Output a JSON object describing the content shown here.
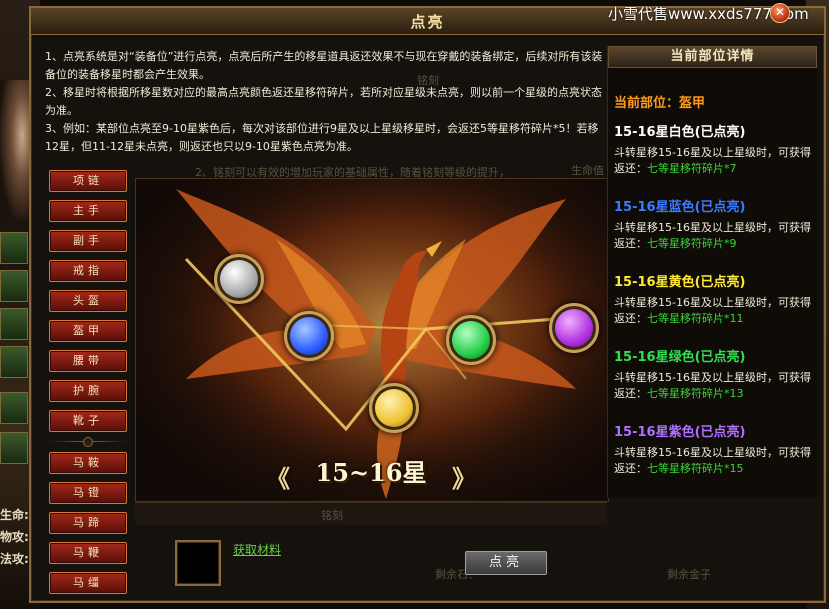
{
  "window": {
    "title": "点亮",
    "watermark": "小雪代售www.xxds777.com",
    "close_glyph": "✕"
  },
  "rules": [
    "1、点亮系统是对“装备位”进行点亮，点亮后所产生的移星道具返还效果不与现在穿戴的装备绑定，后续对所有该装备位的装备移星时都会产生效果。",
    "2、移星时将根据所移星数对应的最高点亮颜色返还星移符碎片，若所对应星级未点亮，则以前一个星级的点亮状态为准。",
    "3、例如：某部位点亮至9-10星紫色后，每次对该部位进行9星及以上星级移星时，会返还5等星移符碎片*5！若移12星，但11-12星未点亮，则返还也只以9-10星紫色点亮为准。"
  ],
  "background_text": {
    "a": "铭刻",
    "b": "2、铭刻可以有效的增加玩家的基础属性，随着铭刻等级的提升，",
    "c": "生命值",
    "d": "铭刻",
    "e": "剩余石：",
    "f": "剩余金子"
  },
  "hero_stats": [
    "生命:",
    "物攻:",
    "法攻:"
  ],
  "slots": [
    {
      "label": "项链"
    },
    {
      "label": "主手"
    },
    {
      "label": "副手"
    },
    {
      "label": "戒指"
    },
    {
      "label": "头盔"
    },
    {
      "label": "盔甲"
    },
    {
      "label": "腰带"
    },
    {
      "label": "护腕"
    },
    {
      "label": "靴子"
    },
    {
      "label": "马鞍"
    },
    {
      "label": "马镫"
    },
    {
      "label": "马蹄"
    },
    {
      "label": "马鞭"
    },
    {
      "label": "马缰"
    }
  ],
  "star_range": "15~16星",
  "orbs": [
    {
      "name": "white-orb",
      "color": "#e8e8e8"
    },
    {
      "name": "blue-orb",
      "color": "#2a5aff"
    },
    {
      "name": "gold-orb",
      "color": "#f0c030"
    },
    {
      "name": "green-orb",
      "color": "#22cc44"
    },
    {
      "name": "purple-orb",
      "color": "#b030e0"
    }
  ],
  "material": {
    "link_text": "获取材料"
  },
  "light_button": "点亮",
  "detail": {
    "header": "当前部位详情",
    "current_part": "当前部位：盔甲",
    "tiers": [
      {
        "title": "15-16星白色(已点亮)",
        "color": "#ffffff",
        "desc": "斗转星移15-16星及以上星级时，可获得返还：",
        "reward": "七等星移符碎片*7"
      },
      {
        "title": "15-16星蓝色(已点亮)",
        "color": "#3a7cff",
        "desc": "斗转星移15-16星及以上星级时，可获得返还：",
        "reward": "七等星移符碎片*9"
      },
      {
        "title": "15-16星黄色(已点亮)",
        "color": "#ffea30",
        "desc": "斗转星移15-16星及以上星级时，可获得返还：",
        "reward": "七等星移符碎片*11"
      },
      {
        "title": "15-16星绿色(已点亮)",
        "color": "#30e050",
        "desc": "斗转星移15-16星及以上星级时，可获得返还：",
        "reward": "七等星移符碎片*13"
      },
      {
        "title": "15-16星紫色(已点亮)",
        "color": "#b070ff",
        "desc": "斗转星移15-16星及以上星级时，可获得返还：",
        "reward": "七等星移符碎片*15"
      }
    ]
  }
}
